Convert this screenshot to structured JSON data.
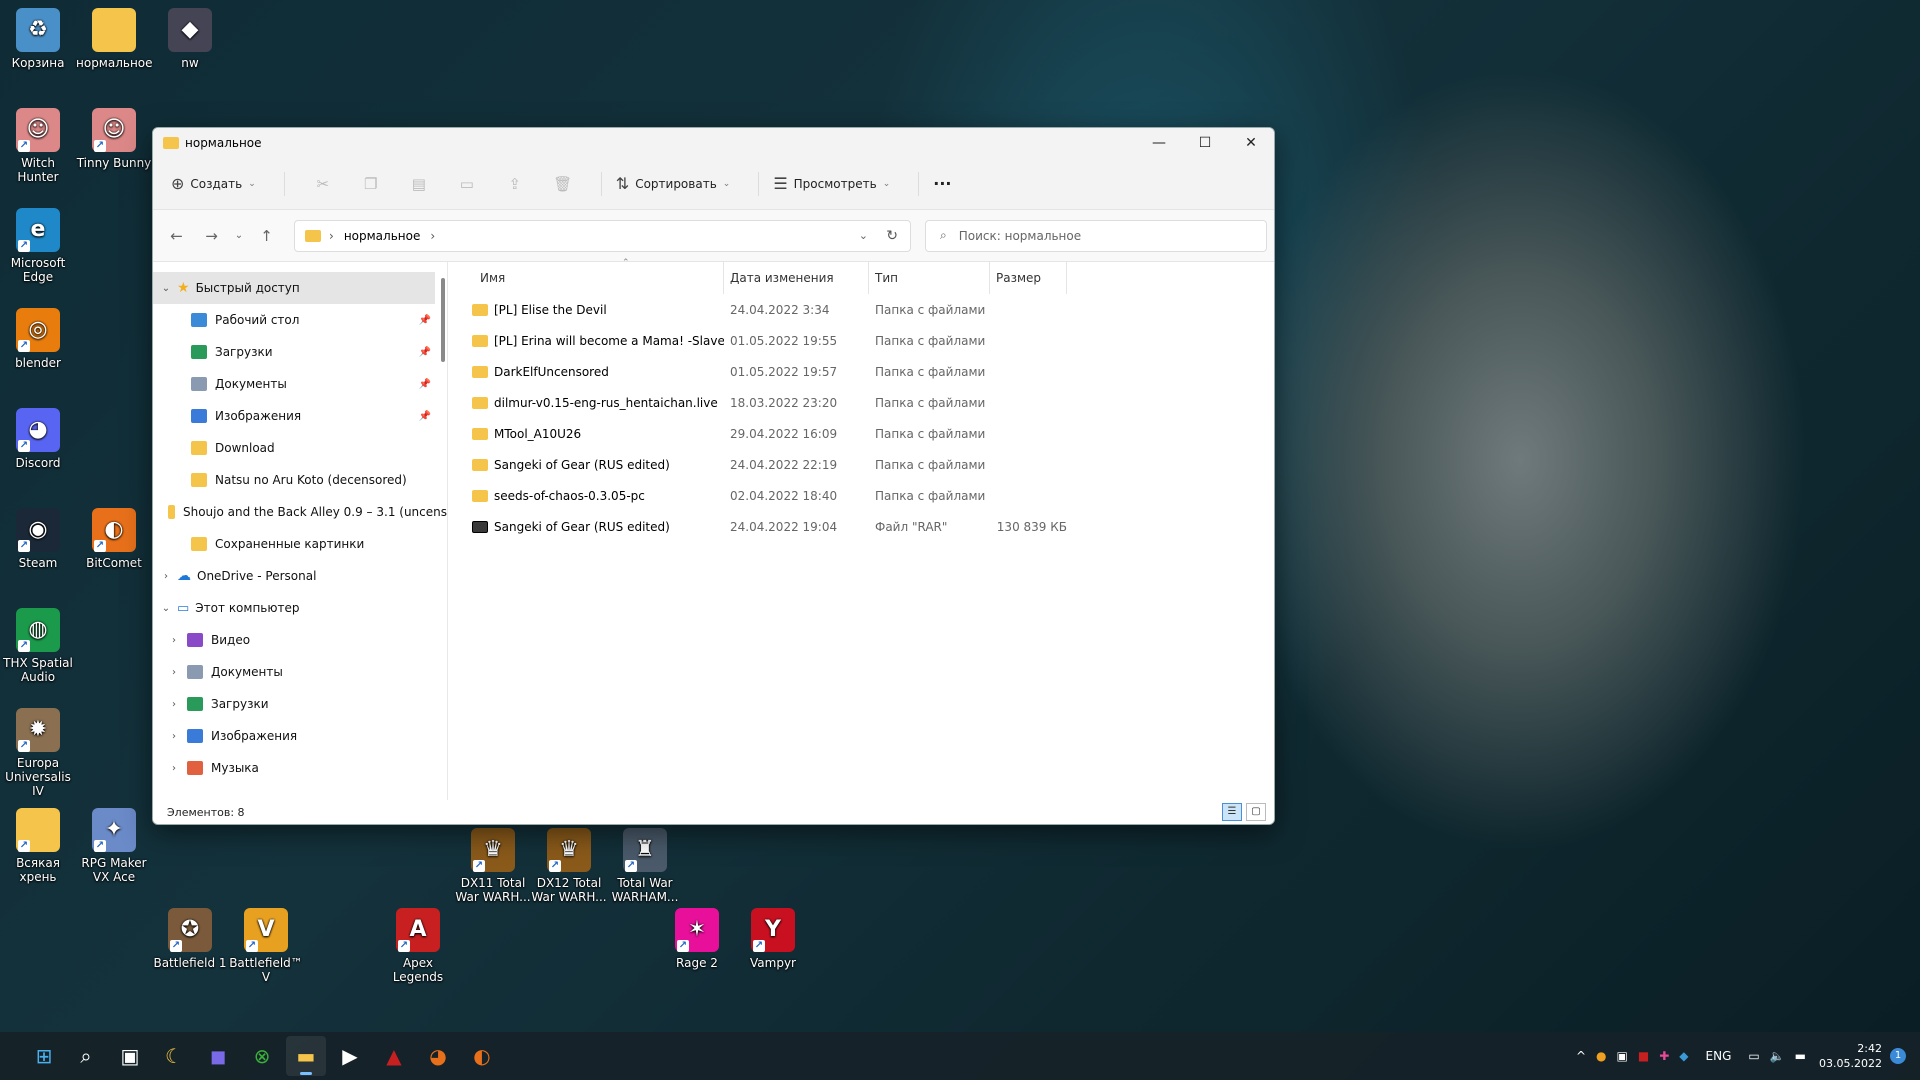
{
  "desktop": {
    "icons": [
      {
        "label": "Корзина",
        "glyph": "♻",
        "color": "#4a90c8"
      },
      {
        "label": "нормальное",
        "glyph": "",
        "color": "#f5c54b"
      },
      {
        "label": "nw",
        "glyph": "◆",
        "color": "#445"
      },
      {
        "label": "Witch Hunter",
        "glyph": "☺",
        "color": "#d88"
      },
      {
        "label": "Tinny Bunny",
        "glyph": "☺",
        "color": "#d88"
      },
      {
        "label": "Microsoft Edge",
        "glyph": "e",
        "color": "#1e88c8"
      },
      {
        "label": "blender",
        "glyph": "◎",
        "color": "#e87d0d"
      },
      {
        "label": "Discord",
        "glyph": "◕",
        "color": "#5865f2"
      },
      {
        "label": "Steam",
        "glyph": "◉",
        "color": "#1b2838"
      },
      {
        "label": "BitComet",
        "glyph": "◐",
        "color": "#e8701a"
      },
      {
        "label": "THX Spatial Audio",
        "glyph": "◍",
        "color": "#1a9a4a"
      },
      {
        "label": "Europa Universalis IV",
        "glyph": "✹",
        "color": "#8a7050"
      },
      {
        "label": "Всякая хрень",
        "glyph": "",
        "color": "#f5c54b"
      },
      {
        "label": "RPG Maker VX Ace",
        "glyph": "✦",
        "color": "#6a8ac8"
      },
      {
        "label": "DX11 Total War WARH...",
        "glyph": "♛",
        "color": "#8a5a1a"
      },
      {
        "label": "DX12 Total War WARH...",
        "glyph": "♛",
        "color": "#8a5a1a"
      },
      {
        "label": "Total War WARHAM...",
        "glyph": "♜",
        "color": "#4a5a6a"
      },
      {
        "label": "Battlefield 1",
        "glyph": "✪",
        "color": "#7a5a3a"
      },
      {
        "label": "Battlefield™ V",
        "glyph": "V",
        "color": "#e8a020"
      },
      {
        "label": "Apex Legends",
        "glyph": "A",
        "color": "#c82020"
      },
      {
        "label": "Rage 2",
        "glyph": "✶",
        "color": "#e8109a"
      },
      {
        "label": "Vampyr",
        "glyph": "Y",
        "color": "#c81020"
      }
    ]
  },
  "window": {
    "title": "нормальное",
    "controls": {
      "minimize": "—",
      "maximize": "☐",
      "close": "✕"
    },
    "toolbar": {
      "create": "Создать",
      "sort": "Сортировать",
      "view": "Просмотреть",
      "more": "···"
    },
    "address": {
      "crumb": "нормальное",
      "search_placeholder": "Поиск: нормальное"
    },
    "nav": {
      "quick_access": "Быстрый доступ",
      "pinned": [
        {
          "label": "Рабочий стол",
          "color": "#3a8ad8",
          "pinned": true
        },
        {
          "label": "Загрузки",
          "color": "#2a9a5a",
          "pinned": true
        },
        {
          "label": "Документы",
          "color": "#8a9ab0",
          "pinned": true
        },
        {
          "label": "Изображения",
          "color": "#3a7ad8",
          "pinned": true
        },
        {
          "label": "Download",
          "color": "#f5c54b",
          "pinned": false
        },
        {
          "label": "Natsu no Aru Koto (decensored)",
          "color": "#f5c54b",
          "pinned": false
        },
        {
          "label": "Shoujo and the Back Alley 0.9 – 3.1 (uncens",
          "color": "#f5c54b",
          "pinned": false
        },
        {
          "label": "Сохраненные картинки",
          "color": "#f5c54b",
          "pinned": false
        }
      ],
      "onedrive": "OneDrive - Personal",
      "this_pc": "Этот компьютер",
      "pc_items": [
        {
          "label": "Видео",
          "color": "#8a4ac8"
        },
        {
          "label": "Документы",
          "color": "#8a9ab0"
        },
        {
          "label": "Загрузки",
          "color": "#2a9a5a"
        },
        {
          "label": "Изображения",
          "color": "#3a7ad8"
        },
        {
          "label": "Музыка",
          "color": "#e06040"
        }
      ]
    },
    "columns": {
      "name": "Имя",
      "date": "Дата изменения",
      "type": "Тип",
      "size": "Размер"
    },
    "files": [
      {
        "name": "[PL] Elise the Devil",
        "date": "24.04.2022 3:34",
        "type": "Папка с файлами",
        "size": "",
        "kind": "folder"
      },
      {
        "name": "[PL] Erina will become a Mama! -Slave Di...",
        "date": "01.05.2022 19:55",
        "type": "Папка с файлами",
        "size": "",
        "kind": "folder"
      },
      {
        "name": "DarkElfUncensored",
        "date": "01.05.2022 19:57",
        "type": "Папка с файлами",
        "size": "",
        "kind": "folder"
      },
      {
        "name": "dilmur-v0.15-eng-rus_hentaichan.live",
        "date": "18.03.2022 23:20",
        "type": "Папка с файлами",
        "size": "",
        "kind": "folder"
      },
      {
        "name": "MTool_A10U26",
        "date": "29.04.2022 16:09",
        "type": "Папка с файлами",
        "size": "",
        "kind": "folder"
      },
      {
        "name": "Sangeki of Gear (RUS edited)",
        "date": "24.04.2022 22:19",
        "type": "Папка с файлами",
        "size": "",
        "kind": "folder"
      },
      {
        "name": "seeds-of-chaos-0.3.05-pc",
        "date": "02.04.2022 18:40",
        "type": "Папка с файлами",
        "size": "",
        "kind": "folder"
      },
      {
        "name": "Sangeki of Gear (RUS edited)",
        "date": "24.04.2022 19:04",
        "type": "Файл \"RAR\"",
        "size": "130 839 КБ",
        "kind": "rar"
      }
    ],
    "status": "Элементов: 8"
  },
  "taskbar": {
    "apps": [
      {
        "name": "start",
        "glyph": "⊞",
        "color": "#4ab0f0"
      },
      {
        "name": "search",
        "glyph": "⌕",
        "color": "#fff"
      },
      {
        "name": "task-view",
        "glyph": "▣",
        "color": "#fff"
      },
      {
        "name": "widgets",
        "glyph": "☾",
        "color": "#f0c040"
      },
      {
        "name": "chat",
        "glyph": "◼",
        "color": "#7a6ae8"
      },
      {
        "name": "xbox",
        "glyph": "⊗",
        "color": "#3ab03a"
      },
      {
        "name": "explorer",
        "glyph": "▬",
        "color": "#f5c54b"
      },
      {
        "name": "media-player",
        "glyph": "▶",
        "color": "#fff"
      },
      {
        "name": "app-red",
        "glyph": "▲",
        "color": "#c82020"
      },
      {
        "name": "firefox",
        "glyph": "◕",
        "color": "#e8701a"
      },
      {
        "name": "bitcomet",
        "glyph": "◐",
        "color": "#e8701a"
      }
    ],
    "tray": {
      "chevron": "^",
      "lang": "ENG",
      "time": "2:42",
      "date": "03.05.2022",
      "notifications": "1"
    }
  }
}
